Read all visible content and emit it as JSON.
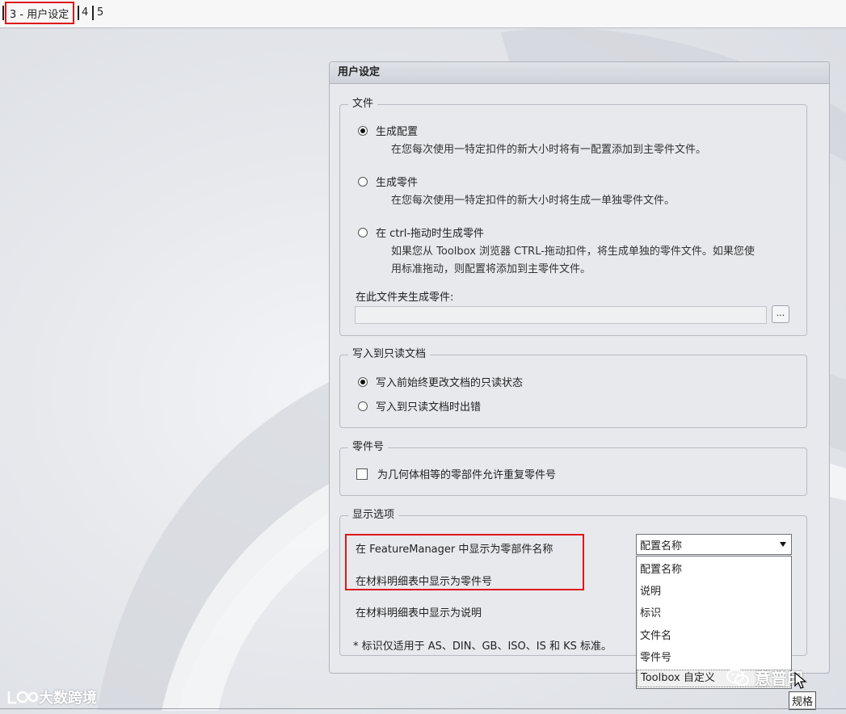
{
  "tabs": {
    "active_label": "3 - 用户设定",
    "tab4_label": "4",
    "tab5_label": "5"
  },
  "panel": {
    "title": "用户设定",
    "file_group": {
      "title": "文件",
      "options": [
        {
          "label": "生成配置",
          "desc": "在您每次使用一特定扣件的新大小时将有一配置添加到主零件文件。",
          "selected": true
        },
        {
          "label": "生成零件",
          "desc": "在您每次使用一特定扣件的新大小时将生成一单独零件文件。",
          "selected": false
        },
        {
          "label": "在 ctrl-拖动时生成零件",
          "desc_line1": "如果您从 Toolbox 浏览器 CTRL-拖动扣件，将生成单独的零件文件。如果您使",
          "desc_line2": "用标准拖动，则配置将添加到主零件文件。",
          "selected": false
        }
      ],
      "folder_label": "在此文件夹生成零件:",
      "folder_value": "",
      "browse_label": "..."
    },
    "readonly_group": {
      "title": "写入到只读文档",
      "options": [
        {
          "label": "写入前始终更改文档的只读状态",
          "selected": true
        },
        {
          "label": "写入到只读文档时出错",
          "selected": false
        }
      ]
    },
    "partno_group": {
      "title": "零件号",
      "checkbox_label": "为几何体相等的零部件允许重复零件号",
      "checked": false
    },
    "display_group": {
      "title": "显示选项",
      "rows": [
        "在 FeatureManager 中显示为零部件名称",
        "在材料明细表中显示为零件号",
        "在材料明细表中显示为说明"
      ],
      "note": "* 标识仅适用于 AS、DIN、GB、ISO、IS 和 KS 标准。",
      "combo_value": "配置名称",
      "dropdown_options": [
        "配置名称",
        "说明",
        "标识",
        "文件名",
        "零件号",
        "Toolbox 自定义"
      ]
    }
  },
  "watermarks": {
    "left": "大数跨境",
    "right": "意普印"
  },
  "tooltip": "规格",
  "colors": {
    "highlight": "#e01616",
    "panel_bg": "#e7e9ed"
  }
}
